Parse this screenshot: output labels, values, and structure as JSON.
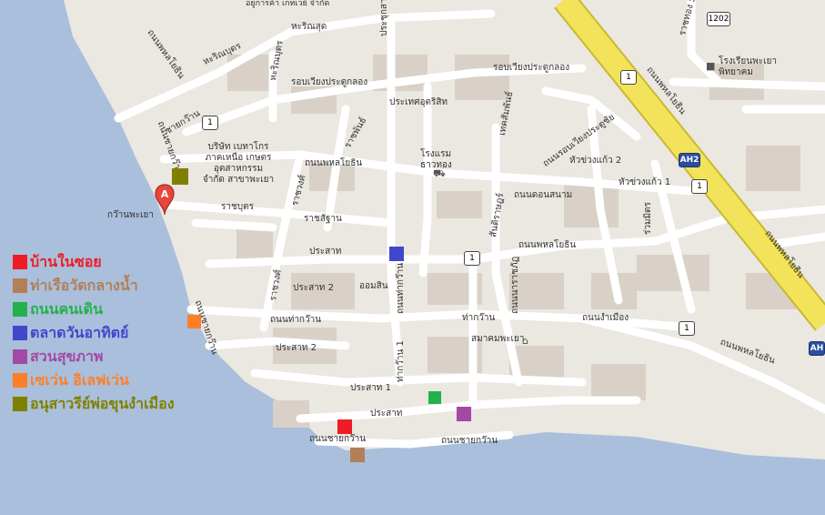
{
  "map": {
    "water_color": "#a9bfdb",
    "land_color": "#ebe7e1",
    "block_color": "#d9d0c7",
    "road_color": "#ffffff",
    "highway_color": "#f3e35a",
    "pin_letter": "A",
    "labels": {
      "charoensuk": "หะริณสุด",
      "top_company": "อยู่การค้า เกทเวย์ จำกัด",
      "prachakluay": "ประชุกสาม",
      "hariboot": "หะริณบุตร",
      "phaholyothin_nw": "ถนนพหลโยธิน",
      "rob_wiang_1": "รอบเวียงประตูกลอง",
      "rob_wiang_2": "รอบเวียงประตูกลอง",
      "sai_kwan": "ชายกว๊าน",
      "company": "บริษัท เบทาโกร ภาคเหนือ เกษตร อุตสาหกรรม จำกัด สาขาพะเยา",
      "phaholyothin_mid": "ถนนพหลโยธิน",
      "ratchaphan": "ราชพันธ์",
      "prachaut": "ประเทศอุตริสิท",
      "hotel": "โรงแรม ธาวทอง",
      "techsamphan": "เทคสัมพันธ์",
      "rob_wiang_pratu": "ถนนรอบเวียงประตูชัย",
      "hua_kwang_2": "หัวข่วงแก้ว 2",
      "hua_kwang_1": "หัวข่วงแก้ว 1",
      "school": "โรงเรียนพะเยา พิทยาคม",
      "ratchabut": "ราชบุตร",
      "ratchasathan": "ราชสัฐาน",
      "kwan_phayao": "กว๊านพะเยา",
      "phaholyothin_hwy": "ถนนพหลโยธิน",
      "don_sanam": "ถนนดอนสนาม",
      "phaholyothin_e": "ถนนพหลโยธิน",
      "prasat": "ประสาท",
      "prasat_2": "ประสาท 2",
      "omsin": "ออมสิน",
      "tha_kwan_road": "ถนนท่ากว๊าน",
      "tha_kwan": "ท่ากว๊าน",
      "tha_kwan_1": "ท่ากว๊าน 1",
      "tha_kwan_v": "ถนนท่ากว๊าน",
      "nam_mueang": "ถนนงำเมือง",
      "association": "สมาคมพะเยา",
      "prasat_2b": "ประสาท 2",
      "prasat_1": "ประสาท 1",
      "prasat_b": "ประสาท",
      "sai_kwan_road": "ถนนชายกว๊าน",
      "sai_kwan_road2": "ถนนชายกว๊าน",
      "phaholyothin_se": "ถนนพหลโยธิน",
      "sai_kwan_v": "ถนนชายกว๊าน",
      "kwan_road_v": "ถนนชายกว๊าน",
      "rachawong": "ราชวงศ์",
      "samakkee": "สันติราษฎร์",
      "nakhon": "ถนนนาราชภัฏ",
      "mukda": "ร่วมมิตร",
      "soi52": "ราชทอง 52"
    },
    "shields": {
      "r1202": "1202",
      "r1_a": "1",
      "r1_b": "1",
      "r1_c": "1",
      "r1_d": "1",
      "r1_e": "1",
      "ah2_a": "AH2",
      "ah2_b": "AH"
    }
  },
  "markers": [
    {
      "name": "marker-house-in-soi",
      "color": "#ee1c24"
    },
    {
      "name": "marker-pier",
      "color": "#b27f59"
    },
    {
      "name": "marker-walking-street",
      "color": "#22b14c"
    },
    {
      "name": "marker-sunday-market",
      "color": "#3f48cc"
    },
    {
      "name": "marker-health-park",
      "color": "#a349a4"
    },
    {
      "name": "marker-seven-eleven",
      "color": "#ff7f27"
    },
    {
      "name": "marker-monument",
      "color": "#808000"
    }
  ],
  "legend": [
    {
      "label": "บ้านในซอย",
      "color": "#ee1c24"
    },
    {
      "label": "ท่าเรือวัดกลางน้ำ",
      "color": "#b27f59"
    },
    {
      "label": "ถนนคนเดิน",
      "color": "#22b14c"
    },
    {
      "label": "ตลาดวันอาทิตย์",
      "color": "#3f48cc"
    },
    {
      "label": "สวนสุขภาพ",
      "color": "#a349a4"
    },
    {
      "label": "เซเว่น อิเลฟเว่น",
      "color": "#ff7f27"
    },
    {
      "label": "อนุสาวรีย์พ่อขุนงำเมือง",
      "color": "#808000"
    }
  ]
}
